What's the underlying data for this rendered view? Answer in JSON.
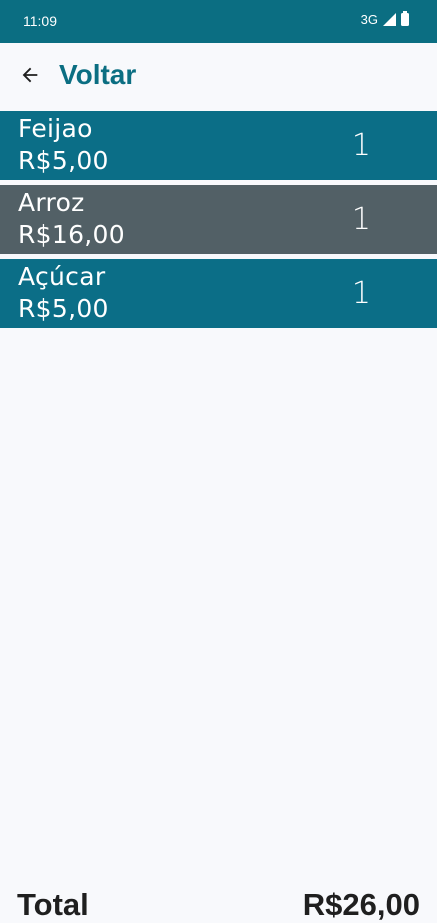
{
  "status_bar": {
    "time": "11:09",
    "network": "3G",
    "icons": [
      "signal-icon",
      "battery-icon"
    ],
    "background": "#0b6e82"
  },
  "app_bar": {
    "back_icon": "arrow-back-icon",
    "title": "Voltar",
    "title_color": "#0b6e82"
  },
  "items": [
    {
      "name": "Feijao",
      "price": "R$5,00",
      "quantity": "1",
      "background": "#0b6e87"
    },
    {
      "name": "Arroz",
      "price": "R$16,00",
      "quantity": "1",
      "background": "#526066"
    },
    {
      "name": "Açúcar",
      "price": "R$5,00",
      "quantity": "1",
      "background": "#0b6e87"
    }
  ],
  "footer": {
    "total_label": "Total",
    "total_value": "R$26,00"
  }
}
